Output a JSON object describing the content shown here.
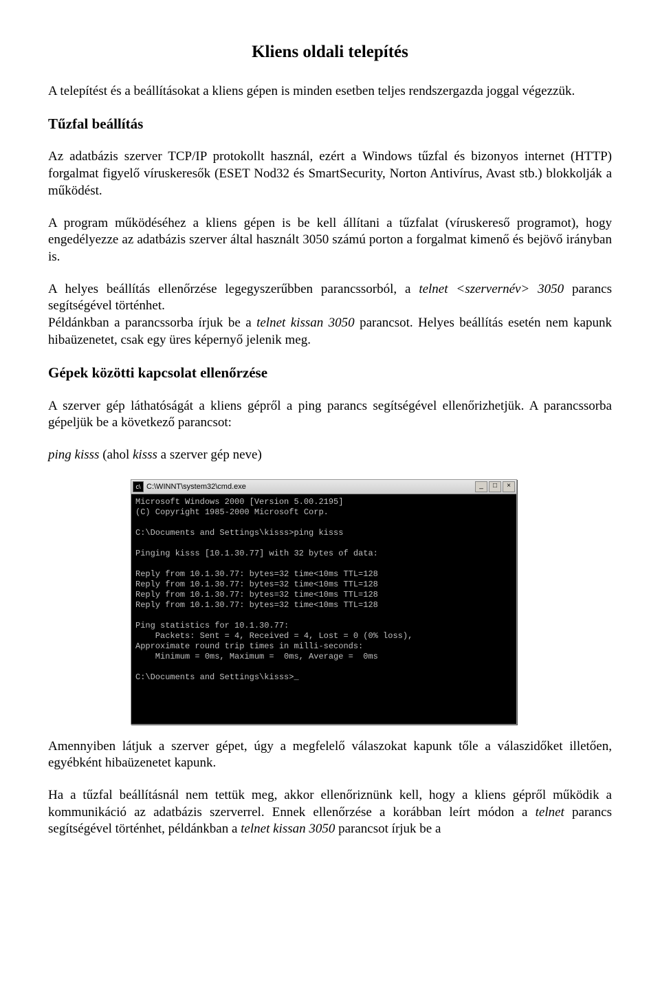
{
  "title": "Kliens oldali telepítés",
  "intro": "A telepítést és a beállításokat a kliens gépen is minden esetben teljes rendszergazda joggal végezzük.",
  "h1": "Tűzfal beállítás",
  "p1": "Az adatbázis szerver TCP/IP protokollt használ, ezért a Windows tűzfal és bizonyos internet (HTTP) forgalmat figyelő víruskeresők (ESET Nod32 és SmartSecurity, Norton Antivírus, Avast stb.) blokkolják a működést.",
  "p2": "A program működéséhez a kliens gépen is be kell állítani a tűzfalat (víruskereső programot), hogy engedélyezze az adatbázis szerver által használt 3050 számú porton a forgalmat kimenő és bejövő irányban is.",
  "p3a": "A helyes beállítás ellenőrzése legegyszerűbben parancssorból, a ",
  "p3b": "telnet <szervernév> 3050",
  "p3c": " parancs segítségével történhet.",
  "p4a": "Példánkban a parancssorba írjuk be a  ",
  "p4b": "telnet kissan 3050",
  "p4c": "  parancsot. Helyes beállítás esetén nem kapunk hibaüzenetet, csak egy üres képernyő jelenik meg.",
  "h2": "Gépek közötti kapcsolat ellenőrzése",
  "p5": "A szerver gép láthatóságát a kliens gépről a ping parancs segítségével ellenőrizhetjük. A parancssorba gépeljük be a következő parancsot:",
  "p6a": "ping  kisss",
  "p6b": "   (ahol ",
  "p6c": "kisss",
  "p6d": " a szerver gép neve)",
  "cmd": {
    "title": "C:\\WINNT\\system32\\cmd.exe",
    "body": "Microsoft Windows 2000 [Version 5.00.2195]\n(C) Copyright 1985-2000 Microsoft Corp.\n\nC:\\Documents and Settings\\kisss>ping kisss\n\nPinging kisss [10.1.30.77] with 32 bytes of data:\n\nReply from 10.1.30.77: bytes=32 time<10ms TTL=128\nReply from 10.1.30.77: bytes=32 time<10ms TTL=128\nReply from 10.1.30.77: bytes=32 time<10ms TTL=128\nReply from 10.1.30.77: bytes=32 time<10ms TTL=128\n\nPing statistics for 10.1.30.77:\n    Packets: Sent = 4, Received = 4, Lost = 0 (0% loss),\nApproximate round trip times in milli-seconds:\n    Minimum = 0ms, Maximum =  0ms, Average =  0ms\n\nC:\\Documents and Settings\\kisss>_"
  },
  "p7": "Amennyiben látjuk a szerver gépet, úgy a megfelelő válaszokat kapunk tőle a válaszidőket illetően, egyébként hibaüzenetet kapunk.",
  "p8a": "Ha a tűzfal beállításnál nem tettük meg, akkor ellenőriznünk kell, hogy a kliens gépről működik a kommunikáció az adatbázis szerverrel. Ennek ellenőrzése a korábban leírt módon a ",
  "p8b": "telnet",
  "p8c": " parancs segítségével történhet, példánkban a  ",
  "p8d": "telnet kissan 3050",
  "p8e": "  parancsot írjuk be a"
}
